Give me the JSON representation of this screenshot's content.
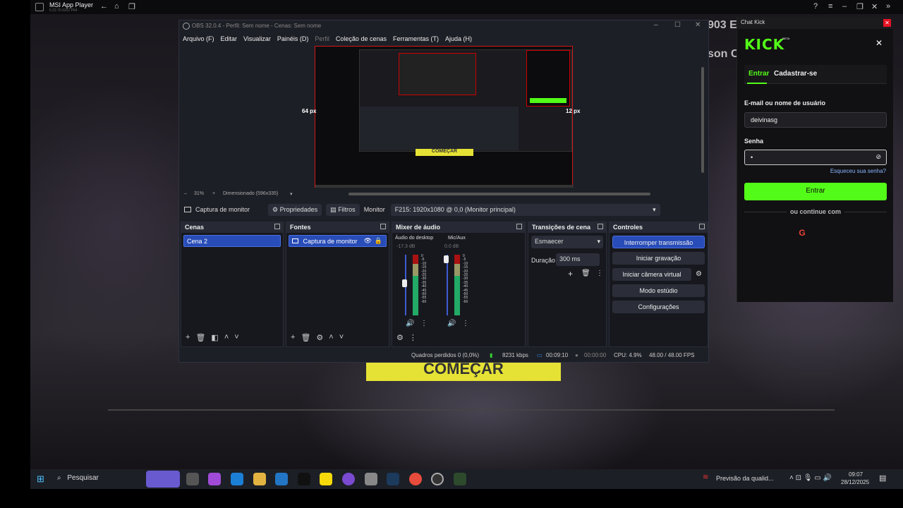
{
  "app_player": {
    "name": "MSI App Player",
    "version": "5.22.70.6322 P64"
  },
  "background": {
    "fragments": [
      "903 E",
      "son C"
    ],
    "banner_text": "COMEÇAR"
  },
  "obs": {
    "title": "OBS 32.0.4 - Perfil: Sem nome - Cenas: Sem nome",
    "menu": [
      "Arquivo (F)",
      "Editar",
      "Visualizar",
      "Painéis (D)",
      "Perfil",
      "Coleção de cenas",
      "Ferramentas (T)",
      "Ajuda (H)"
    ],
    "preview": {
      "left_label": "64 px",
      "right_label": "12 px",
      "zoom": "31%",
      "scale": "Dimensionado (596x335)"
    },
    "source_toolbar": {
      "source": "Captura de monitor",
      "properties": "Propriedades",
      "filters": "Filtros",
      "monitor_label": "Monitor",
      "monitor_value": "F215: 1920x1080 @ 0,0 (Monitor principal)"
    },
    "scenes": {
      "title": "Cenas",
      "items": [
        "Cena 2"
      ]
    },
    "sources": {
      "title": "Fontes",
      "items": [
        "Captura de monitor"
      ]
    },
    "mixer": {
      "title": "Mixer de áudio",
      "channels": [
        {
          "name": "Áudio do desktop",
          "db": "-17.3 dB"
        },
        {
          "name": "Mic/Aux",
          "db": "0.0 dB"
        }
      ],
      "scale": [
        "0",
        "-5",
        "-10",
        "-15",
        "-20",
        "-25",
        "-30",
        "-35",
        "-40",
        "-45",
        "-50",
        "-55",
        "-60"
      ]
    },
    "transitions": {
      "title": "Transições de cena",
      "type": "Esmaecer",
      "duration_label": "Duração",
      "duration": "300 ms"
    },
    "controls": {
      "title": "Controles",
      "buttons": [
        "Interromper transmissão",
        "Iniciar gravação",
        "Iniciar câmera virtual",
        "Modo estúdio",
        "Configurações"
      ]
    },
    "status": {
      "dropped": "Quadros perdidos 0 (0,0%)",
      "bitrate": "8231 kbps",
      "live_time": "00:09:10",
      "rec_time": "00:00:00",
      "cpu": "CPU: 4.9%",
      "fps": "48.00 / 48.00 FPS"
    }
  },
  "kick": {
    "window_title": "Chat Kick",
    "logo": "KICK",
    "beta": "BETA",
    "tabs": [
      "Entrar",
      "Cadastrar-se"
    ],
    "email_label": "E-mail ou nome de usuário",
    "email_value": "deivinasg",
    "password_label": "Senha",
    "password_value": "•",
    "forgot": "Esqueceu sua senha?",
    "submit": "Entrar",
    "or_continue": "ou continue com",
    "accent": "#53fc18"
  },
  "taskbar": {
    "search": "Pesquisar",
    "weather": "Previsão da qualid...",
    "time": "09:07",
    "date": "28/12/2025"
  }
}
